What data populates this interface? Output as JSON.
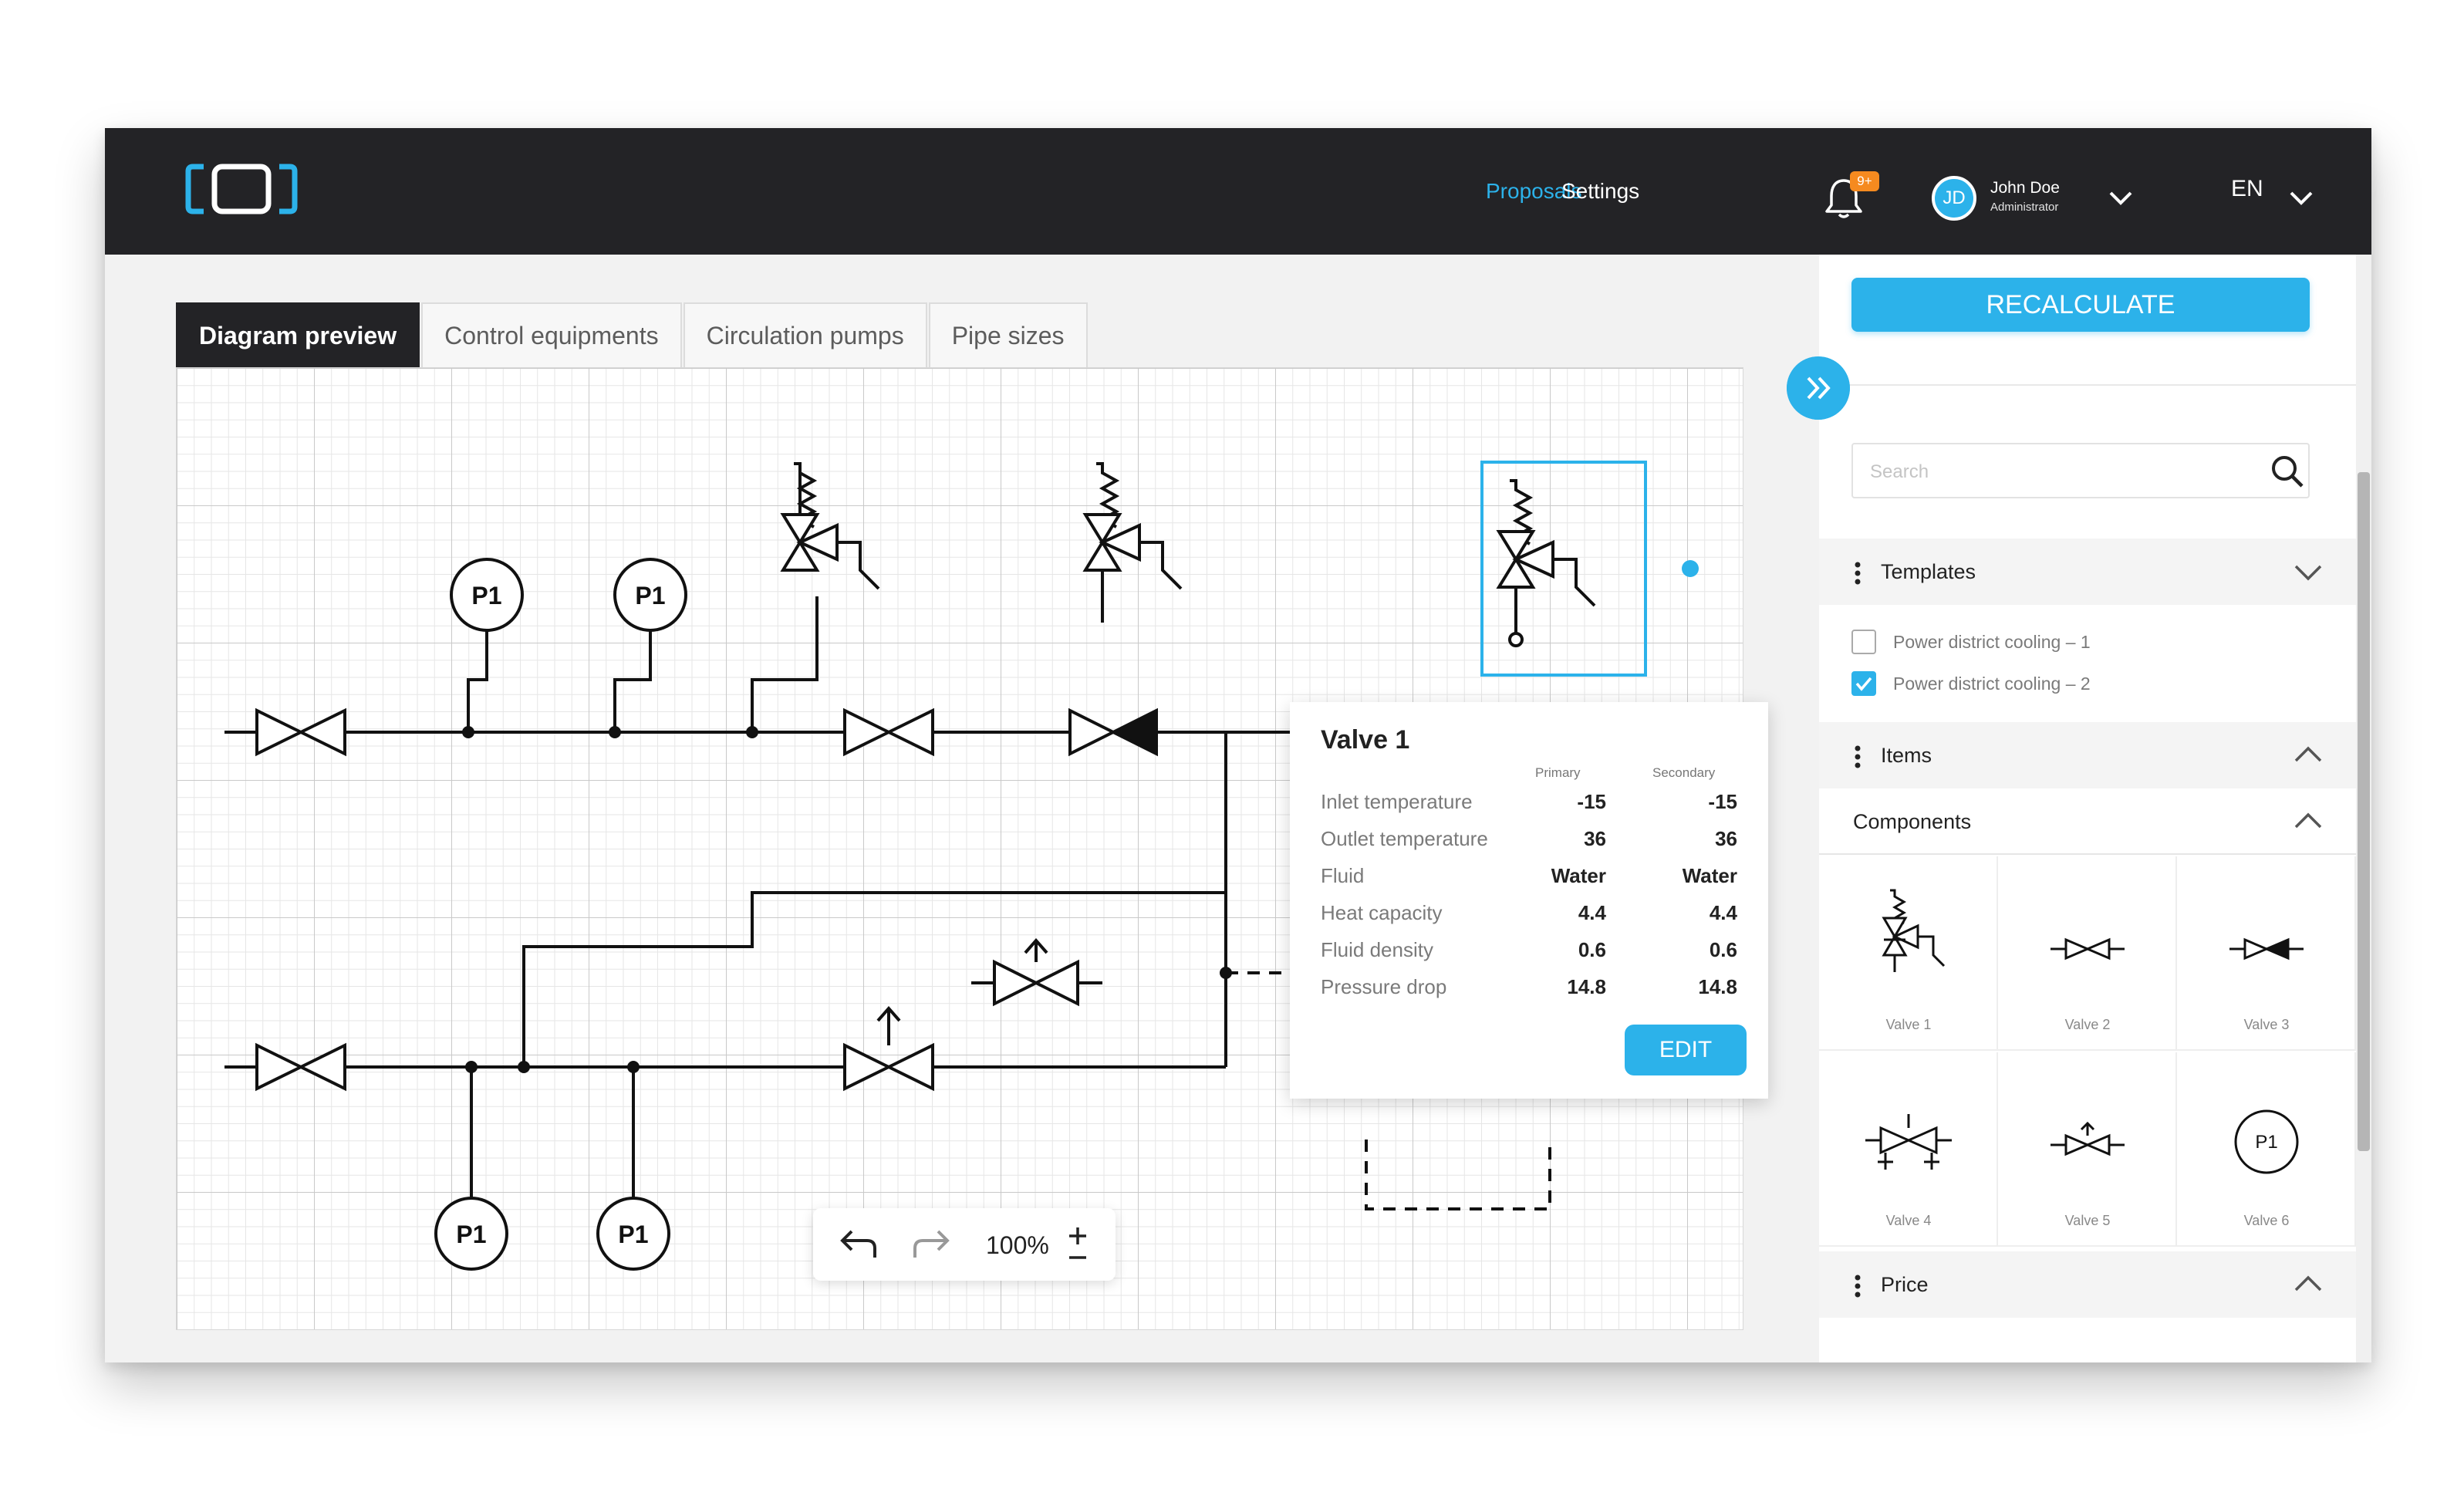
{
  "header": {
    "nav": [
      "Proposals",
      "Settings"
    ],
    "notifications_badge": "9+",
    "user": {
      "initials": "JD",
      "name": "John Doe",
      "role": "Administrator"
    },
    "language": "EN"
  },
  "tabs": [
    "Diagram preview",
    "Control equipments",
    "Circulation pumps",
    "Pipe sizes"
  ],
  "diagram": {
    "gauge_labels": [
      "P1",
      "P1",
      "P1",
      "P1"
    ]
  },
  "popup": {
    "title": "Valve 1",
    "columns": [
      "Primary",
      "Secondary"
    ],
    "rows": [
      {
        "label": "Inlet temperature",
        "primary": "-15",
        "secondary": "-15"
      },
      {
        "label": "Outlet temperature",
        "primary": "36",
        "secondary": "36"
      },
      {
        "label": "Fluid",
        "primary": "Water",
        "secondary": "Water"
      },
      {
        "label": "Heat capacity",
        "primary": "4.4",
        "secondary": "4.4"
      },
      {
        "label": "Fluid density",
        "primary": "0.6",
        "secondary": "0.6"
      },
      {
        "label": "Pressure drop",
        "primary": "14.8",
        "secondary": "14.8"
      }
    ],
    "edit_label": "EDIT"
  },
  "zoom": {
    "level": "100%"
  },
  "sidebar": {
    "recalculate_label": "RECALCULATE",
    "search_placeholder": "Search",
    "templates": {
      "title": "Templates",
      "items": [
        {
          "label": "Power district cooling – 1",
          "checked": false
        },
        {
          "label": "Power district cooling – 2",
          "checked": true
        }
      ]
    },
    "items_title": "Items",
    "components": {
      "title": "Components",
      "items": [
        "Valve 1",
        "Valve 2",
        "Valve 3",
        "Valve 4",
        "Valve 5",
        "Valve 6"
      ],
      "valve6_symbol": "P1"
    },
    "price_title": "Price"
  },
  "colors": {
    "accent": "#2cb2ea",
    "header_bg": "#232326",
    "badge": "#f58a1f"
  }
}
